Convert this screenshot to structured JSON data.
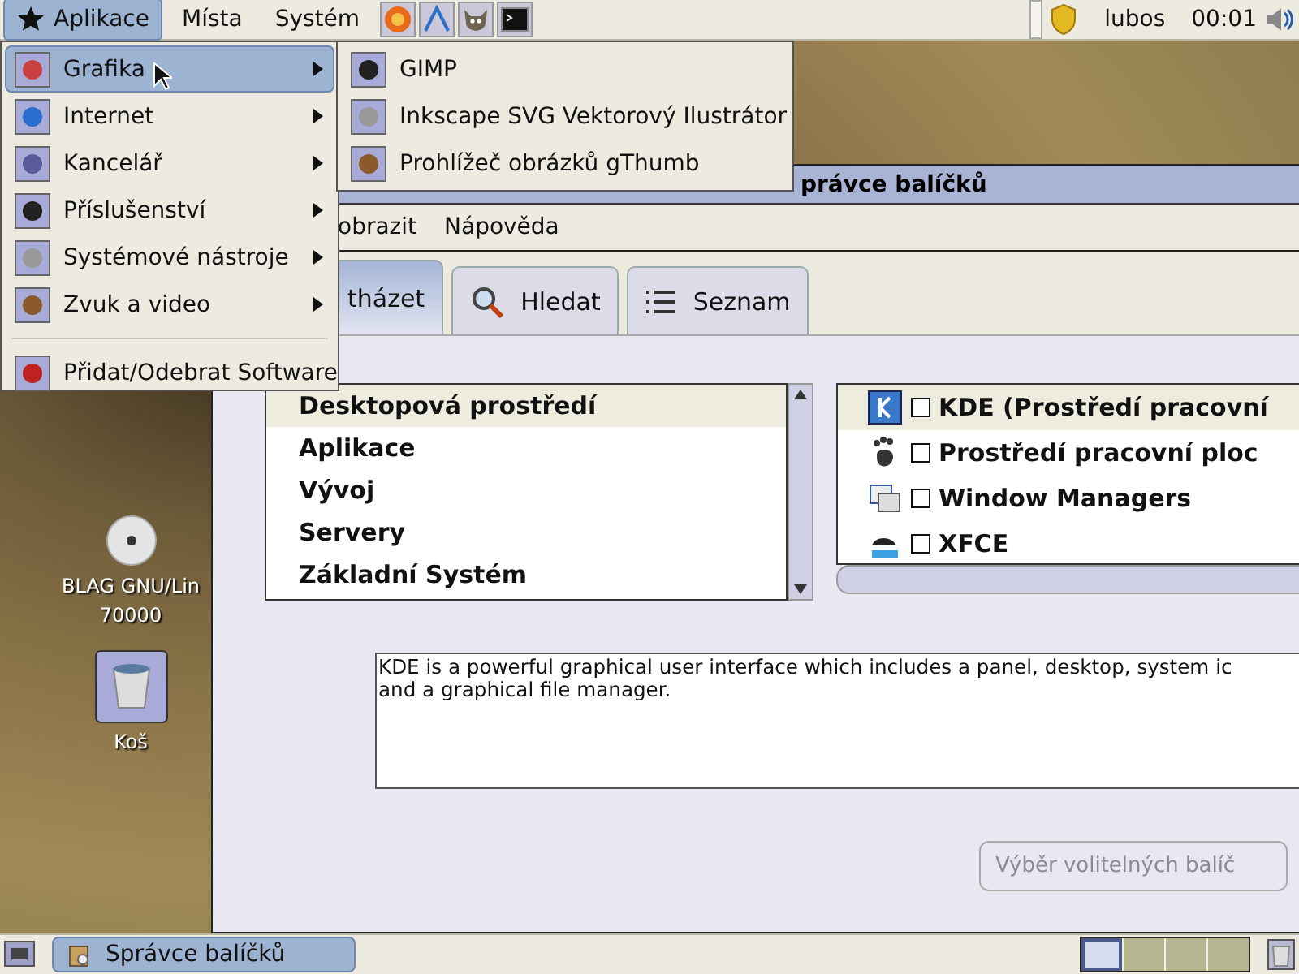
{
  "top_panel": {
    "menus": [
      {
        "label": "Aplikace",
        "selected": true
      },
      {
        "label": "Místa",
        "selected": false
      },
      {
        "label": "Systém",
        "selected": false
      }
    ],
    "user": "lubos",
    "clock": "00:01"
  },
  "applications_menu": {
    "items": [
      {
        "label": "Grafika",
        "selected": true,
        "kind": "submenu"
      },
      {
        "label": "Internet",
        "selected": false,
        "kind": "submenu"
      },
      {
        "label": "Kancelář",
        "selected": false,
        "kind": "submenu"
      },
      {
        "label": "Příslušenství",
        "selected": false,
        "kind": "submenu"
      },
      {
        "label": "Systémové nástroje",
        "selected": false,
        "kind": "submenu"
      },
      {
        "label": "Zvuk a video",
        "selected": false,
        "kind": "submenu"
      },
      {
        "label": "Přidat/Odebrat Software",
        "selected": false,
        "kind": "action"
      }
    ]
  },
  "graphics_submenu": {
    "items": [
      {
        "label": "GIMP"
      },
      {
        "label": "Inkscape SVG Vektorový Ilustrátor"
      },
      {
        "label": "Prohlížeč obrázků gThumb"
      }
    ]
  },
  "desktop_icons": [
    {
      "kind": "disc",
      "lines": [
        "BLAG GNU/Lin",
        "70000"
      ]
    },
    {
      "kind": "trash",
      "lines": [
        "Koš"
      ]
    }
  ],
  "window": {
    "title": "právce balíčků",
    "menus": [
      "obrazit",
      "Nápověda"
    ],
    "tabs": [
      {
        "label": "tházet",
        "selected": true,
        "kind": "browse"
      },
      {
        "label": "Hledat",
        "selected": false,
        "kind": "search"
      },
      {
        "label": "Seznam",
        "selected": false,
        "kind": "list"
      }
    ],
    "groups": [
      {
        "label": "Desktopová prostředí",
        "selected": true
      },
      {
        "label": "Aplikace",
        "selected": false
      },
      {
        "label": "Vývoj",
        "selected": false
      },
      {
        "label": "Servery",
        "selected": false
      },
      {
        "label": "Základní Systém",
        "selected": false
      }
    ],
    "packages": [
      {
        "label": "KDE (Prostředí pracovní",
        "checked": false,
        "selected": true,
        "kind": "kde"
      },
      {
        "label": "Prostředí pracovní ploc",
        "checked": false,
        "selected": false,
        "kind": "foot"
      },
      {
        "label": "Window Managers",
        "checked": false,
        "selected": false,
        "kind": "windows"
      },
      {
        "label": "XFCE",
        "checked": false,
        "selected": false,
        "kind": "xfce"
      }
    ],
    "description": [
      "KDE is a powerful graphical user interface which includes a panel, desktop, system ic",
      "and a graphical file manager."
    ],
    "optional_button": {
      "label": "Výběr volitelných balíč",
      "disabled": true
    }
  },
  "bottom_panel": {
    "tasks": [
      {
        "label": "Správce balíčků",
        "selected": true
      }
    ],
    "workspaces": [
      {
        "selected": true
      },
      {
        "selected": false
      },
      {
        "selected": false
      },
      {
        "selected": false
      }
    ]
  }
}
